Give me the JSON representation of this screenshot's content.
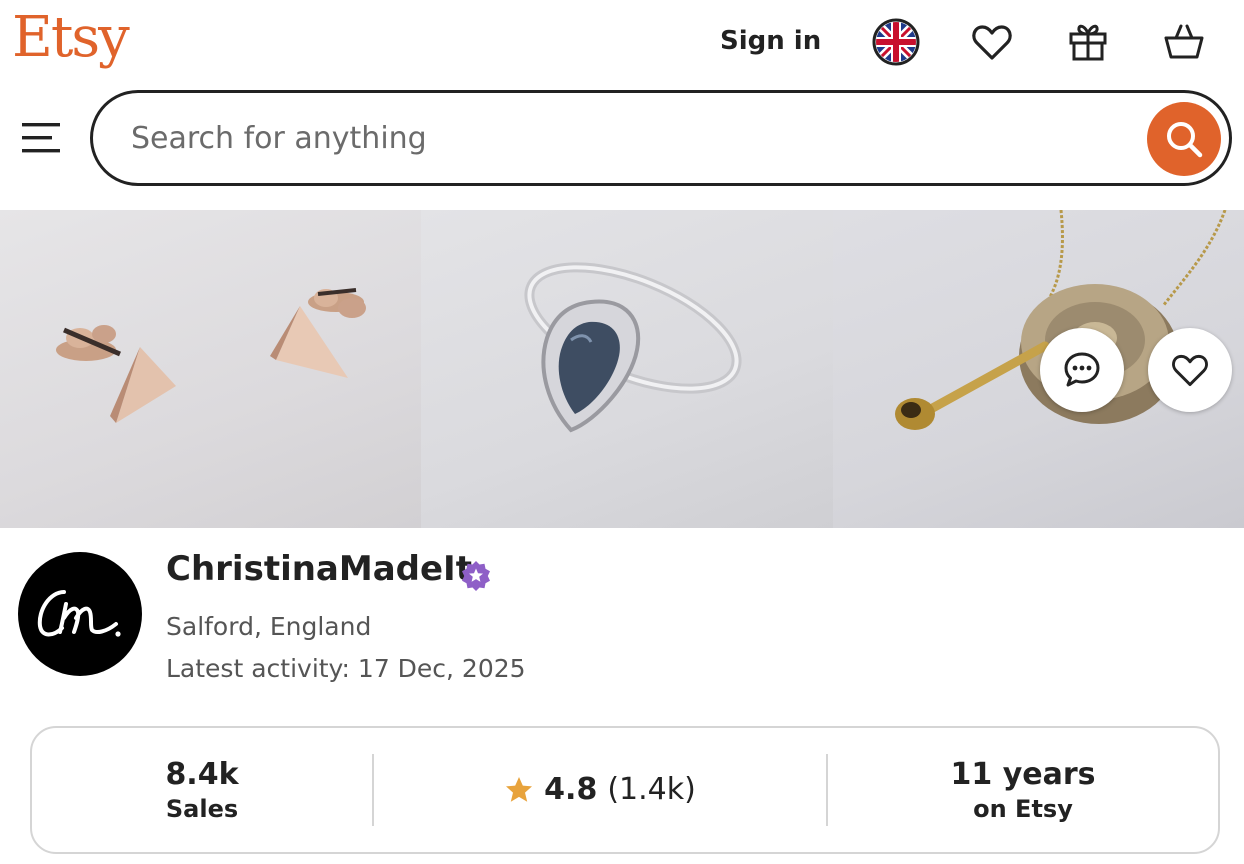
{
  "header": {
    "logo": "Etsy",
    "sign_in": "Sign in",
    "icons": [
      "uk-flag-icon",
      "heart-icon",
      "gift-icon",
      "basket-icon"
    ]
  },
  "search": {
    "placeholder": "Search for anything",
    "value": ""
  },
  "banner": {
    "images": [
      "triangle-earrings-photo",
      "teardrop-ring-photo",
      "pendant-necklace-photo"
    ],
    "actions": [
      "message-icon",
      "favorite-icon"
    ]
  },
  "shop": {
    "name": "ChristinaMadeIt",
    "location": "Salford, England",
    "latest_activity": "Latest activity: 17 Dec, 2025",
    "avatar_text": "Cm."
  },
  "stats": {
    "sales_value": "8.4k",
    "sales_label": "Sales",
    "rating_value": "4.8",
    "rating_count": "(1.4k)",
    "years_value": "11 years",
    "years_label": "on Etsy"
  },
  "colors": {
    "brand": "#E0632B",
    "verified_badge": "#8E5FC7",
    "star": "#E8A33C"
  }
}
